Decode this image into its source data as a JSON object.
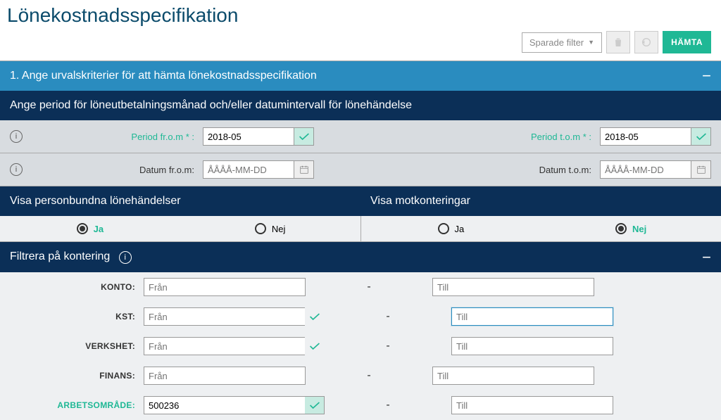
{
  "page_title": "Lönekostnadsspecifikation",
  "toolbar": {
    "saved_filter_label": "Sparade filter",
    "fetch_label": "HÄMTA"
  },
  "section1": {
    "title": "1. Ange urvalskriterier för att hämta lönekostnadsspecifikation",
    "collapse": "−"
  },
  "period_bar": "Ange period för löneutbetalningsmånad och/eller datumintervall för lönehändelse",
  "period": {
    "from_label": "Period fr.o.m * :",
    "from_value": "2018-05",
    "to_label": "Period t.o.m * :",
    "to_value": "2018-05"
  },
  "date": {
    "from_label": "Datum fr.o.m:",
    "from_placeholder": "ÅÅÅÅ-MM-DD",
    "to_label": "Datum t.o.m:",
    "to_placeholder": "ÅÅÅÅ-MM-DD"
  },
  "visa": {
    "left_title": "Visa personbundna lönehändelser",
    "right_title": "Visa motkonteringar",
    "ja": "Ja",
    "nej": "Nej"
  },
  "filter_bar": {
    "title": "Filtrera på kontering",
    "collapse": "−"
  },
  "filters": {
    "konto_label": "KONTO:",
    "kst_label": "KST:",
    "verkshet_label": "VERKSHET:",
    "finans_label": "FINANS:",
    "arbetsomrade_label": "ARBETSOMRÅDE:",
    "from_placeholder": "Från",
    "till_placeholder": "Till",
    "arbetsomrade_value": "500236",
    "dash": "-"
  }
}
